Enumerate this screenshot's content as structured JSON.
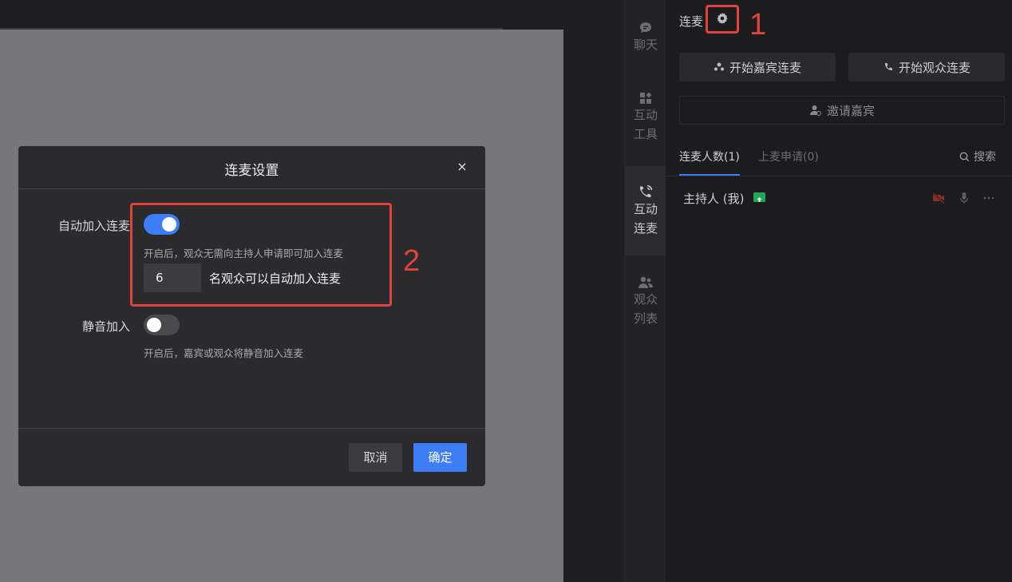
{
  "dialog": {
    "title": "连麦设置",
    "close_glyph": "×",
    "auto_join": {
      "label": "自动加入连麦",
      "enabled": true,
      "hint": "开启后，观众无需向主持人申请即可加入连麦",
      "count_value": "6",
      "count_suffix": "名观众可以自动加入连麦"
    },
    "mute_join": {
      "label": "静音加入",
      "enabled": false,
      "hint": "开启后，嘉宾或观众将静音加入连麦"
    },
    "cancel_label": "取消",
    "confirm_label": "确定"
  },
  "annotations": {
    "num1": "1",
    "num2": "2"
  },
  "sidenav": {
    "items": [
      {
        "label": "聊天",
        "icon": "chat-bubble-icon",
        "active": false
      },
      {
        "label": "互动工具",
        "line1": "互动",
        "line2": "工具",
        "icon": "grid-icon",
        "active": false
      },
      {
        "label": "互动连麦",
        "line1": "互动",
        "line2": "连麦",
        "icon": "phone-signal-icon",
        "active": true
      },
      {
        "label": "观众列表",
        "line1": "观众",
        "line2": "列表",
        "icon": "users-icon",
        "active": false
      }
    ]
  },
  "panel": {
    "title": "连麦",
    "start_guest_label": "开始嘉宾连麦",
    "start_audience_label": "开始观众连麦",
    "invite_label": "邀请嘉宾",
    "tabs": {
      "count_label": "连麦人数(1)",
      "apply_label": "上麦申请(0)"
    },
    "search_label": "搜索",
    "host": {
      "name": "主持人 (我)"
    }
  },
  "colors": {
    "accent": "#3d7ef7",
    "annotation": "#e0433b",
    "host_badge": "#21a857",
    "camera_off": "#c0392b"
  }
}
